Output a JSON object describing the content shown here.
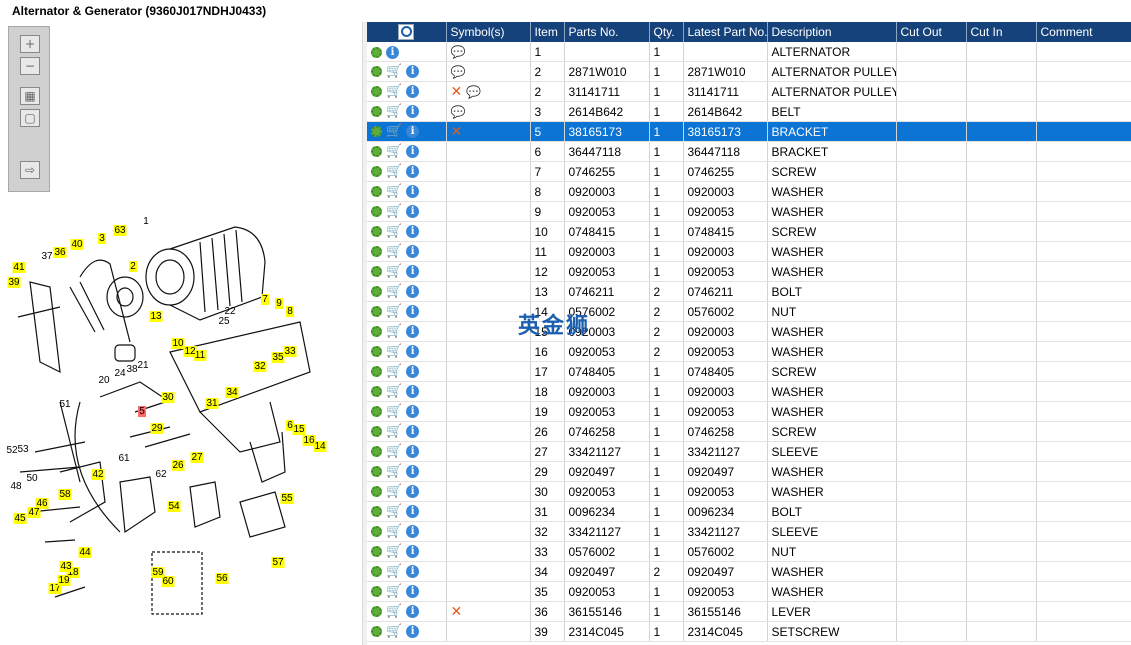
{
  "title": "Alternator & Generator (9360J017NDHJ0433)",
  "toolbar": {
    "buttons": [
      {
        "name": "zoom-in-button",
        "glyph": "+"
      },
      {
        "name": "zoom-out-button",
        "glyph": "−"
      },
      {
        "name": "fit-all-button",
        "glyph": "▦"
      },
      {
        "name": "actual-size-button",
        "glyph": "▢"
      },
      {
        "name": "export-button",
        "glyph": "⇨"
      }
    ]
  },
  "table": {
    "search_icon": "magnifier-icon",
    "columns": [
      "Symbol(s)",
      "Item",
      "Parts No.",
      "Qty.",
      "Latest Part No.",
      "Description",
      "Cut Out",
      "Cut In",
      "Comment"
    ],
    "rows": [
      {
        "cart": false,
        "symbols": [
          "bubble"
        ],
        "item": "1",
        "part": "",
        "qty": "1",
        "latest": "",
        "desc": "ALTERNATOR",
        "sel": false
      },
      {
        "cart": true,
        "symbols": [
          "bubble"
        ],
        "item": "2",
        "part": "2871W010",
        "qty": "1",
        "latest": "2871W010",
        "desc": "ALTERNATOR PULLEY",
        "sel": false
      },
      {
        "cart": true,
        "symbols": [
          "x",
          "bubble"
        ],
        "item": "2",
        "part": "31141711",
        "qty": "1",
        "latest": "31141711",
        "desc": "ALTERNATOR PULLEY",
        "sel": false
      },
      {
        "cart": true,
        "symbols": [
          "bubble"
        ],
        "item": "3",
        "part": "2614B642",
        "qty": "1",
        "latest": "2614B642",
        "desc": "BELT",
        "sel": false
      },
      {
        "cart": true,
        "symbols": [
          "x"
        ],
        "item": "5",
        "part": "38165173",
        "qty": "1",
        "latest": "38165173",
        "desc": "BRACKET",
        "sel": true
      },
      {
        "cart": true,
        "symbols": [],
        "item": "6",
        "part": "36447118",
        "qty": "1",
        "latest": "36447118",
        "desc": "BRACKET",
        "sel": false
      },
      {
        "cart": true,
        "symbols": [],
        "item": "7",
        "part": "0746255",
        "qty": "1",
        "latest": "0746255",
        "desc": "SCREW",
        "sel": false
      },
      {
        "cart": true,
        "symbols": [],
        "item": "8",
        "part": "0920003",
        "qty": "1",
        "latest": "0920003",
        "desc": "WASHER",
        "sel": false
      },
      {
        "cart": true,
        "symbols": [],
        "item": "9",
        "part": "0920053",
        "qty": "1",
        "latest": "0920053",
        "desc": "WASHER",
        "sel": false
      },
      {
        "cart": true,
        "symbols": [],
        "item": "10",
        "part": "0748415",
        "qty": "1",
        "latest": "0748415",
        "desc": "SCREW",
        "sel": false
      },
      {
        "cart": true,
        "symbols": [],
        "item": "11",
        "part": "0920003",
        "qty": "1",
        "latest": "0920003",
        "desc": "WASHER",
        "sel": false
      },
      {
        "cart": true,
        "symbols": [],
        "item": "12",
        "part": "0920053",
        "qty": "1",
        "latest": "0920053",
        "desc": "WASHER",
        "sel": false
      },
      {
        "cart": true,
        "symbols": [],
        "item": "13",
        "part": "0746211",
        "qty": "2",
        "latest": "0746211",
        "desc": "BOLT",
        "sel": false
      },
      {
        "cart": true,
        "symbols": [],
        "item": "14",
        "part": "0576002",
        "qty": "2",
        "latest": "0576002",
        "desc": "NUT",
        "sel": false
      },
      {
        "cart": true,
        "symbols": [],
        "item": "15",
        "part": "0920003",
        "qty": "2",
        "latest": "0920003",
        "desc": "WASHER",
        "sel": false
      },
      {
        "cart": true,
        "symbols": [],
        "item": "16",
        "part": "0920053",
        "qty": "2",
        "latest": "0920053",
        "desc": "WASHER",
        "sel": false
      },
      {
        "cart": true,
        "symbols": [],
        "item": "17",
        "part": "0748405",
        "qty": "1",
        "latest": "0748405",
        "desc": "SCREW",
        "sel": false
      },
      {
        "cart": true,
        "symbols": [],
        "item": "18",
        "part": "0920003",
        "qty": "1",
        "latest": "0920003",
        "desc": "WASHER",
        "sel": false
      },
      {
        "cart": true,
        "symbols": [],
        "item": "19",
        "part": "0920053",
        "qty": "1",
        "latest": "0920053",
        "desc": "WASHER",
        "sel": false
      },
      {
        "cart": true,
        "symbols": [],
        "item": "26",
        "part": "0746258",
        "qty": "1",
        "latest": "0746258",
        "desc": "SCREW",
        "sel": false
      },
      {
        "cart": true,
        "symbols": [],
        "item": "27",
        "part": "33421127",
        "qty": "1",
        "latest": "33421127",
        "desc": "SLEEVE",
        "sel": false
      },
      {
        "cart": true,
        "symbols": [],
        "item": "29",
        "part": "0920497",
        "qty": "1",
        "latest": "0920497",
        "desc": "WASHER",
        "sel": false
      },
      {
        "cart": true,
        "symbols": [],
        "item": "30",
        "part": "0920053",
        "qty": "1",
        "latest": "0920053",
        "desc": "WASHER",
        "sel": false
      },
      {
        "cart": true,
        "symbols": [],
        "item": "31",
        "part": "0096234",
        "qty": "1",
        "latest": "0096234",
        "desc": "BOLT",
        "sel": false
      },
      {
        "cart": true,
        "symbols": [],
        "item": "32",
        "part": "33421127",
        "qty": "1",
        "latest": "33421127",
        "desc": "SLEEVE",
        "sel": false
      },
      {
        "cart": true,
        "symbols": [],
        "item": "33",
        "part": "0576002",
        "qty": "1",
        "latest": "0576002",
        "desc": "NUT",
        "sel": false
      },
      {
        "cart": true,
        "symbols": [],
        "item": "34",
        "part": "0920497",
        "qty": "2",
        "latest": "0920497",
        "desc": "WASHER",
        "sel": false
      },
      {
        "cart": true,
        "symbols": [],
        "item": "35",
        "part": "0920053",
        "qty": "1",
        "latest": "0920053",
        "desc": "WASHER",
        "sel": false
      },
      {
        "cart": true,
        "symbols": [
          "x"
        ],
        "item": "36",
        "part": "36155146",
        "qty": "1",
        "latest": "36155146",
        "desc": "LEVER",
        "sel": false
      },
      {
        "cart": true,
        "symbols": [],
        "item": "39",
        "part": "2314C045",
        "qty": "1",
        "latest": "2314C045",
        "desc": "SETSCREW",
        "sel": false
      }
    ]
  },
  "watermark": "英金狮",
  "diagram": {
    "highlight_color": "#ffff00",
    "selected_color": "#ff6b6b",
    "callouts": [
      "1",
      "2",
      "3",
      "5",
      "6",
      "7",
      "8",
      "9",
      "10",
      "11",
      "12",
      "13",
      "14",
      "15",
      "16",
      "17",
      "18",
      "19",
      "20",
      "21",
      "22",
      "24",
      "25",
      "26",
      "27",
      "29",
      "30",
      "31",
      "32",
      "33",
      "34",
      "35",
      "36",
      "37",
      "38",
      "39",
      "40",
      "41",
      "42",
      "43",
      "44",
      "45",
      "46",
      "47",
      "48",
      "50",
      "51",
      "52",
      "53",
      "54",
      "55",
      "56",
      "57",
      "58",
      "59",
      "60",
      "61",
      "62",
      "63"
    ]
  }
}
